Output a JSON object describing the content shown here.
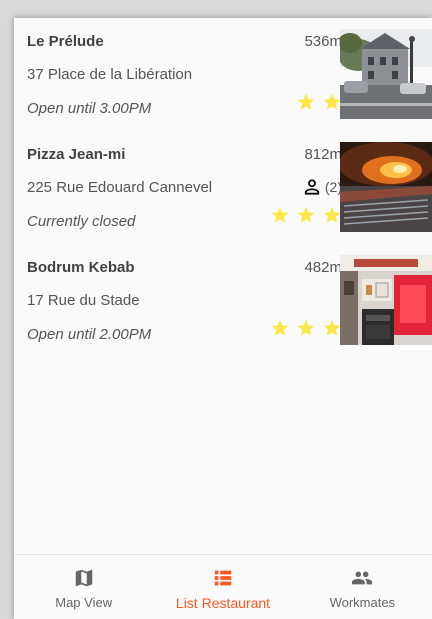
{
  "colors": {
    "accent": "#ff5722",
    "star": "#fce74a",
    "text": "#555555",
    "title": "#424242",
    "icon": "#666666"
  },
  "restaurants": [
    {
      "name": "Le Prélude",
      "distance": "536m",
      "address": "37 Place de la Libération",
      "hours": "Open until  3.00PM",
      "rating": 2,
      "workmates": null,
      "photo": "street-scene-photo"
    },
    {
      "name": "Pizza Jean-mi",
      "distance": "812m",
      "address": "225 Rue Edouard Cannevel",
      "hours": "Currently closed",
      "rating": 3,
      "workmates": "(2)",
      "photo": "pizza-oven-photo"
    },
    {
      "name": "Bodrum Kebab",
      "distance": "482m",
      "address": "17 Rue du Stade",
      "hours": "Open until  2.00PM",
      "rating": 3,
      "workmates": null,
      "photo": "kebab-shop-photo"
    }
  ],
  "bottom_nav": {
    "items": [
      {
        "label": "Map View",
        "icon": "map-icon",
        "active": false
      },
      {
        "label": "List Restaurant",
        "icon": "list-icon",
        "active": true
      },
      {
        "label": "Workmates",
        "icon": "people-icon",
        "active": false
      }
    ]
  }
}
